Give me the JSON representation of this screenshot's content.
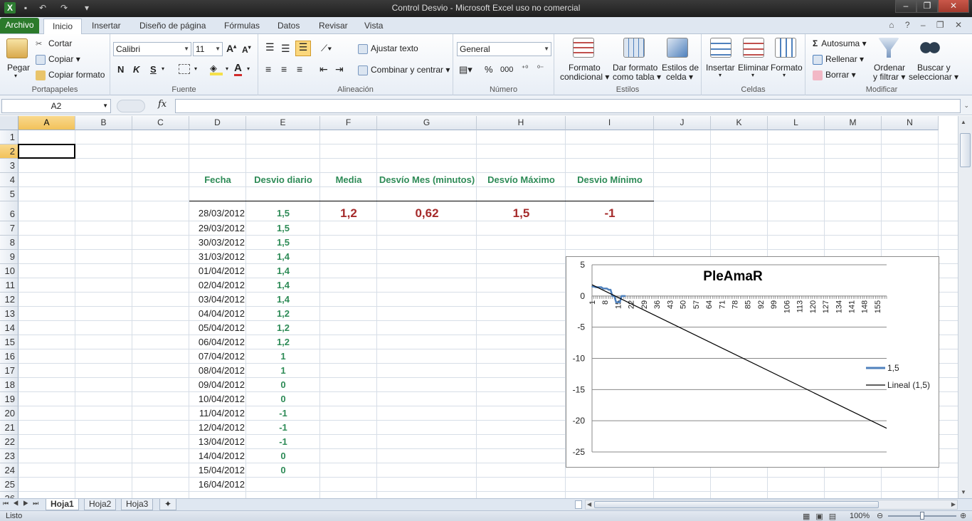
{
  "window": {
    "title": "Control Desvio  -  Microsoft Excel uso no comercial"
  },
  "tabs": [
    "Archivo",
    "Inicio",
    "Insertar",
    "Diseño de página",
    "Fórmulas",
    "Datos",
    "Revisar",
    "Vista"
  ],
  "ribbon": {
    "clipboard": {
      "paste": "Pegar",
      "cut": "Cortar",
      "copy": "Copiar",
      "format_painter": "Copiar formato",
      "label": "Portapapeles"
    },
    "font": {
      "name": "Calibri",
      "size": "11",
      "bold": "N",
      "italic": "K",
      "underline": "S",
      "label": "Fuente"
    },
    "alignment": {
      "wrap": "Ajustar texto",
      "merge": "Combinar y centrar",
      "label": "Alineación"
    },
    "number": {
      "format": "General",
      "percent": "%",
      "thousands": "000",
      "label": "Número"
    },
    "styles": {
      "conditional1": "Formato",
      "conditional2": "condicional",
      "table1": "Dar formato",
      "table2": "como tabla",
      "cell1": "Estilos de",
      "cell2": "celda",
      "label": "Estilos"
    },
    "cells": {
      "insert": "Insertar",
      "delete": "Eliminar",
      "format": "Formato",
      "label": "Celdas"
    },
    "editing": {
      "autosum": "Autosuma",
      "fill": "Rellenar",
      "clear": "Borrar",
      "sort1": "Ordenar",
      "sort2": "y filtrar",
      "find1": "Buscar y",
      "find2": "seleccionar",
      "label": "Modificar"
    }
  },
  "formula_bar": {
    "name_box": "A2",
    "fx": "fx",
    "value": ""
  },
  "columns": [
    "A",
    "B",
    "C",
    "D",
    "E",
    "F",
    "G",
    "H",
    "I",
    "J",
    "K",
    "L",
    "M",
    "N"
  ],
  "rows": [
    "1",
    "2",
    "3",
    "4",
    "5",
    "6",
    "7",
    "8",
    "9",
    "10",
    "11",
    "12",
    "13",
    "14",
    "15",
    "16",
    "17",
    "18",
    "19",
    "20",
    "21",
    "22",
    "23",
    "24",
    "25",
    "26"
  ],
  "headers": {
    "fecha": "Fecha",
    "desvio": "Desvio diario",
    "media": "Media",
    "desvio_mes": "Desvío Mes (minutos)",
    "max": "Desvío Máximo",
    "min": "Desvio Mínimo"
  },
  "summary": {
    "media": "1,2",
    "desvio_mes": "0,62",
    "max": "1,5",
    "min": "-1"
  },
  "data_rows": [
    {
      "fecha": "28/03/2012",
      "desvio": "1,5"
    },
    {
      "fecha": "29/03/2012",
      "desvio": "1,5"
    },
    {
      "fecha": "30/03/2012",
      "desvio": "1,5"
    },
    {
      "fecha": "31/03/2012",
      "desvio": "1,4"
    },
    {
      "fecha": "01/04/2012",
      "desvio": "1,4"
    },
    {
      "fecha": "02/04/2012",
      "desvio": "1,4"
    },
    {
      "fecha": "03/04/2012",
      "desvio": "1,4"
    },
    {
      "fecha": "04/04/2012",
      "desvio": "1,2"
    },
    {
      "fecha": "05/04/2012",
      "desvio": "1,2"
    },
    {
      "fecha": "06/04/2012",
      "desvio": "1,2"
    },
    {
      "fecha": "07/04/2012",
      "desvio": "1"
    },
    {
      "fecha": "08/04/2012",
      "desvio": "1"
    },
    {
      "fecha": "09/04/2012",
      "desvio": "0"
    },
    {
      "fecha": "10/04/2012",
      "desvio": "0"
    },
    {
      "fecha": "11/04/2012",
      "desvio": "-1"
    },
    {
      "fecha": "12/04/2012",
      "desvio": "-1"
    },
    {
      "fecha": "13/04/2012",
      "desvio": "-1"
    },
    {
      "fecha": "14/04/2012",
      "desvio": "0"
    },
    {
      "fecha": "15/04/2012",
      "desvio": "0"
    },
    {
      "fecha": "16/04/2012",
      "desvio": ""
    }
  ],
  "sheets": [
    "Hoja1",
    "Hoja2",
    "Hoja3"
  ],
  "status": {
    "ready": "Listo",
    "zoom": "100%"
  },
  "chart_data": {
    "type": "line",
    "title": "PleAmaR",
    "ylim": [
      -25,
      5
    ],
    "yticks": [
      5,
      0,
      -5,
      -10,
      -15,
      -20,
      -25
    ],
    "xticks": [
      "1",
      "8",
      "15",
      "22",
      "29",
      "36",
      "43",
      "50",
      "57",
      "64",
      "71",
      "78",
      "85",
      "92",
      "99",
      "106",
      "113",
      "120",
      "127",
      "134",
      "141",
      "148",
      "155"
    ],
    "xlim": [
      1,
      160
    ],
    "series": [
      {
        "name": "1,5",
        "x": [
          1,
          2,
          3,
          4,
          5,
          6,
          7,
          8,
          9,
          10,
          11,
          12,
          13,
          14,
          15,
          16,
          17,
          18,
          19
        ],
        "values": [
          1.5,
          1.5,
          1.4,
          1.4,
          1.4,
          1.4,
          1.2,
          1.2,
          1.2,
          1,
          1,
          0,
          0,
          -1,
          -1,
          -1,
          0,
          0,
          0
        ],
        "color": "#4f81bd"
      },
      {
        "name": "Lineal (1,5)",
        "x": [
          1,
          160
        ],
        "values": [
          1.8,
          -21.2
        ],
        "color": "#000000"
      }
    ],
    "legend_position": "right",
    "grid": true
  }
}
